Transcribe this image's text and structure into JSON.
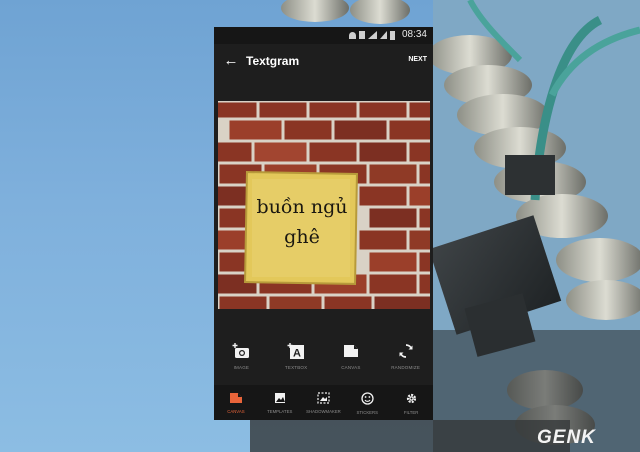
{
  "status_bar": {
    "time": "08:34"
  },
  "app_bar": {
    "title": "Textgram",
    "next_label": "NEXT"
  },
  "canvas": {
    "text_line1": "buồn ngủ",
    "text_line2": "ghê"
  },
  "tools": [
    {
      "label": "IMAGE",
      "icon": "add-photo-icon"
    },
    {
      "label": "TEXTBOX",
      "icon": "add-text-icon"
    },
    {
      "label": "CANVAS",
      "icon": "canvas-icon"
    },
    {
      "label": "RANDOMIZE",
      "icon": "randomize-icon"
    }
  ],
  "bottom_nav": [
    {
      "label": "CANVAS",
      "icon": "canvas-icon",
      "active": true
    },
    {
      "label": "TEMPLATES",
      "icon": "image-icon"
    },
    {
      "label": "SHADOWMAKER",
      "icon": "shadow-icon"
    },
    {
      "label": "STICKERS",
      "icon": "smiley-icon"
    },
    {
      "label": "FILTER",
      "icon": "gear-icon"
    }
  ],
  "watermark": "GENK",
  "colors": {
    "accent": "#e8643a",
    "app_bg": "#1e1e1e",
    "card": "#e3c85a"
  }
}
